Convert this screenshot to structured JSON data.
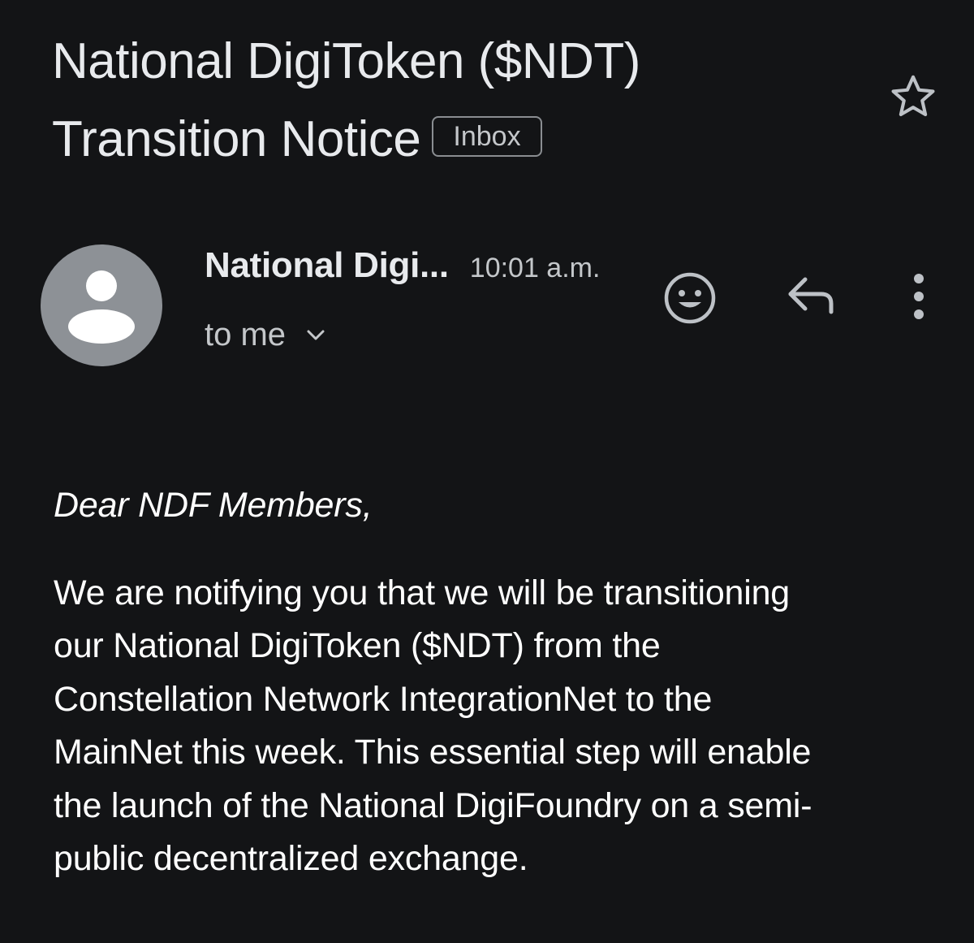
{
  "email": {
    "subject_line1": "National DigiToken ($NDT)",
    "subject_line2": "Transition Notice",
    "label": "Inbox",
    "sender_name": "National Digi...",
    "time": "10:01 a.m.",
    "recipient": "to me",
    "greeting": "Dear NDF Members,",
    "body_lines": [
      "We are notifying you that we will be transitioning",
      "our National DigiToken ($NDT) from the",
      "Constellation Network IntegrationNet to the",
      "MainNet this week. This essential step will enable",
      "the launch of the National DigiFoundry on a semi-",
      "public decentralized exchange."
    ]
  },
  "icons": {
    "star": "star-outline-icon",
    "avatar": "person-icon",
    "expand": "chevron-down-icon",
    "emoji": "add-emoji-reaction-icon",
    "reply": "reply-arrow-icon",
    "more": "more-vertical-icon"
  },
  "colors": {
    "background": "#131416",
    "primary_text": "#e8eaed",
    "secondary_text": "#c4c7ca",
    "avatar_bg": "#8d9196"
  }
}
